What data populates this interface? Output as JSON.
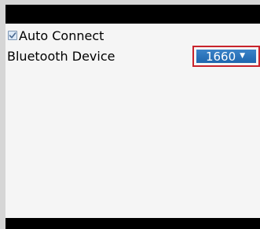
{
  "auto_connect": {
    "label": "Auto Connect",
    "checked": true
  },
  "bluetooth_device": {
    "label": "Bluetooth Device",
    "selected_value": "1660",
    "caret_icon": "chevron-down-icon"
  },
  "colors": {
    "dropdown_bg": "#2a74bc",
    "highlight_border": "#c8232c",
    "content_bg": "#f5f5f5",
    "bars": "#000000"
  }
}
